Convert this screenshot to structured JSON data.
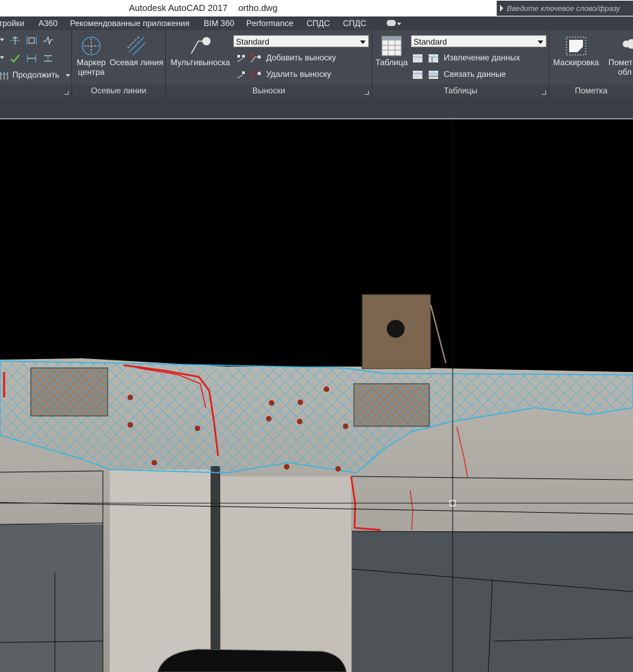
{
  "titlebar": {
    "app_title": "Autodesk AutoCAD 2017",
    "file_name": "ortho.dwg",
    "search_placeholder": "Введите ключевое слово/фразу"
  },
  "tabs": [
    "тройки",
    "A360",
    "Рекомендованные приложения",
    "BIM 360",
    "Performance",
    "СПДС",
    "СПДС"
  ],
  "ribbon": {
    "dimensions_panel": {
      "continue_label": "Продолжить"
    },
    "centerlines_panel": {
      "title": "Осевые линии",
      "center_mark_line1": "Маркер",
      "center_mark_line2": "центра",
      "centerline_label": "Осевая линия"
    },
    "leaders_panel": {
      "title": "Выноски",
      "multileader_label": "Мультивыноска",
      "style_value": "Standard",
      "add_leader_label": "Добавить выноску",
      "remove_leader_label": "Удалить выноску"
    },
    "tables_panel": {
      "title": "Таблицы",
      "table_label": "Таблица",
      "style_value": "Standard",
      "extract_data_label": "Извлечение данных",
      "link_data_label": "Связать данные"
    },
    "markup_panel": {
      "title": "Пометка",
      "wipeout_label": "Маскировка",
      "markup_line1": "Помет",
      "markup_line2": "обл"
    }
  },
  "colors": {
    "accent_red": "#e31b1b",
    "hatch_blue": "#2fb4e6",
    "ribbon_bg": "#454a52"
  }
}
